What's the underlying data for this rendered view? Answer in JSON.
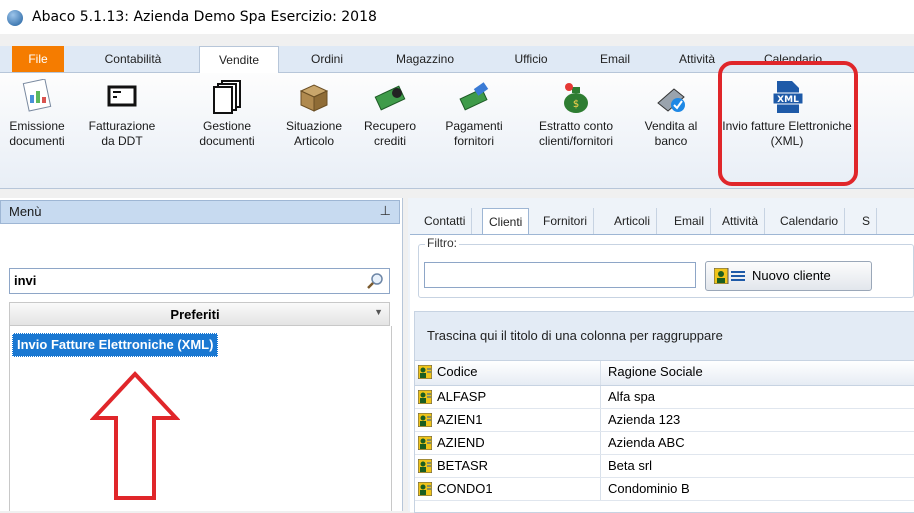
{
  "window": {
    "title": "Abaco 5.1.13: Azienda Demo Spa Esercizio: 2018"
  },
  "menu_tabs": [
    {
      "label": "File"
    },
    {
      "label": "Contabilità"
    },
    {
      "label": "Vendite"
    },
    {
      "label": "Ordini"
    },
    {
      "label": "Magazzino"
    },
    {
      "label": "Ufficio"
    },
    {
      "label": "Email"
    },
    {
      "label": "Attività"
    },
    {
      "label": "Calendario"
    }
  ],
  "ribbon": {
    "emissione": "Emissione documenti",
    "fatturazione": "Fatturazione da DDT",
    "gestione": "Gestione documenti",
    "situazione": "Situazione Articolo",
    "recupero": "Recupero crediti",
    "pagamenti": "Pagamenti fornitori",
    "estratto": "Estratto conto clienti/fornitori",
    "vendita": "Vendita al banco",
    "invio": "Invio fatture Elettroniche (XML)",
    "xml_icon_text": "XML"
  },
  "left_panel": {
    "title": "Menù",
    "search_value": "invi",
    "preferiti": "Preferiti",
    "selected_item": "Invio Fatture Elettroniche (XML)"
  },
  "right_tabs": [
    {
      "label": "Contatti"
    },
    {
      "label": "Clienti"
    },
    {
      "label": "Fornitori"
    },
    {
      "label": "Articoli"
    },
    {
      "label": "Email"
    },
    {
      "label": "Attività"
    },
    {
      "label": "Calendario"
    },
    {
      "label": "S"
    }
  ],
  "filter": {
    "label": "Filtro:",
    "value": "",
    "new_button": "Nuovo cliente"
  },
  "grid": {
    "group_hint": "Trascina qui il titolo di una colonna per raggruppare",
    "columns": [
      "Codice",
      "Ragione Sociale"
    ],
    "rows": [
      {
        "code": "ALFASP",
        "name": "Alfa spa"
      },
      {
        "code": "AZIEN1",
        "name": "Azienda 123"
      },
      {
        "code": "AZIEND",
        "name": "Azienda ABC"
      },
      {
        "code": "BETASR",
        "name": "Beta srl"
      },
      {
        "code": "CONDO1",
        "name": "Condominio B"
      }
    ]
  },
  "colors": {
    "highlight": "#e0262a",
    "selection": "#1a78d2",
    "file_tab": "#f57c00"
  }
}
